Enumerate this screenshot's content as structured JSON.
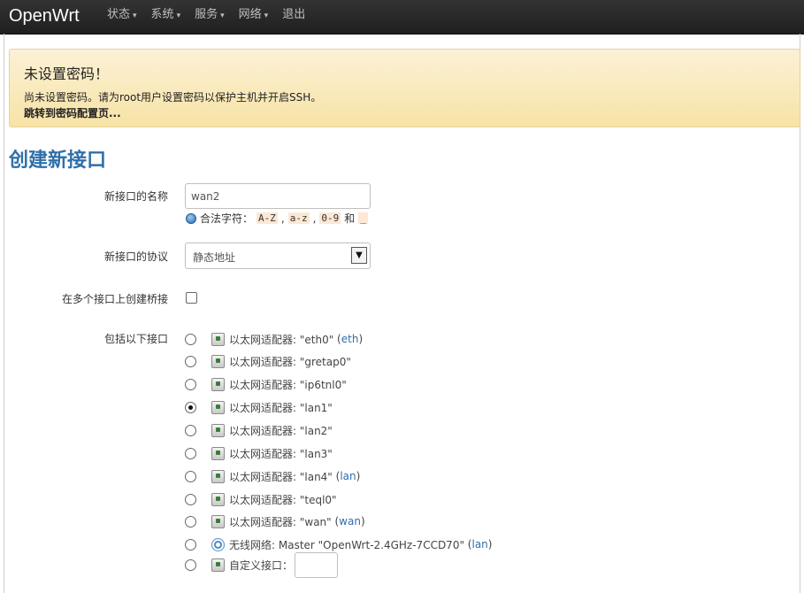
{
  "navbar": {
    "brand": "OpenWrt",
    "menu": [
      {
        "label": "状态",
        "has_caret": true
      },
      {
        "label": "系统",
        "has_caret": true
      },
      {
        "label": "服务",
        "has_caret": true
      },
      {
        "label": "网络",
        "has_caret": true
      },
      {
        "label": "退出",
        "has_caret": false
      }
    ],
    "caret": "▾"
  },
  "alert": {
    "title": "未设置密码！",
    "message": "尚未设置密码。请为root用户设置密码以保护主机并开启SSH。",
    "link": "跳转到密码配置页..."
  },
  "page_title": "创建新接口",
  "form": {
    "name_label": "新接口的名称",
    "name_value": "wan2",
    "name_hint": {
      "prefix": "合法字符：",
      "codes": [
        "A-Z",
        "a-z",
        "0-9"
      ],
      "sep": ",",
      "and": "和",
      "underscore": "_"
    },
    "protocol_label": "新接口的协议",
    "protocol_value": "静态地址",
    "bridge_label": "在多个接口上创建桥接",
    "bridge_checked": false,
    "include_label": "包括以下接口",
    "interfaces": [
      {
        "kind": "eth",
        "text": "以太网适配器: \"eth0\"",
        "network": "eth",
        "checked": false
      },
      {
        "kind": "eth",
        "text": "以太网适配器: \"gretap0\"",
        "network": "",
        "checked": false
      },
      {
        "kind": "eth",
        "text": "以太网适配器: \"ip6tnl0\"",
        "network": "",
        "checked": false
      },
      {
        "kind": "eth",
        "text": "以太网适配器: \"lan1\"",
        "network": "",
        "checked": true
      },
      {
        "kind": "eth",
        "text": "以太网适配器: \"lan2\"",
        "network": "",
        "checked": false
      },
      {
        "kind": "eth",
        "text": "以太网适配器: \"lan3\"",
        "network": "",
        "checked": false
      },
      {
        "kind": "eth",
        "text": "以太网适配器: \"lan4\"",
        "network": "lan",
        "checked": false
      },
      {
        "kind": "eth",
        "text": "以太网适配器: \"teql0\"",
        "network": "",
        "checked": false
      },
      {
        "kind": "eth",
        "text": "以太网适配器: \"wan\"",
        "network": "wan",
        "checked": false
      },
      {
        "kind": "wifi",
        "text": "无线网络: Master \"OpenWrt-2.4GHz-7CCD70\"",
        "network": "lan",
        "checked": false
      }
    ],
    "custom_label": "自定义接口："
  }
}
